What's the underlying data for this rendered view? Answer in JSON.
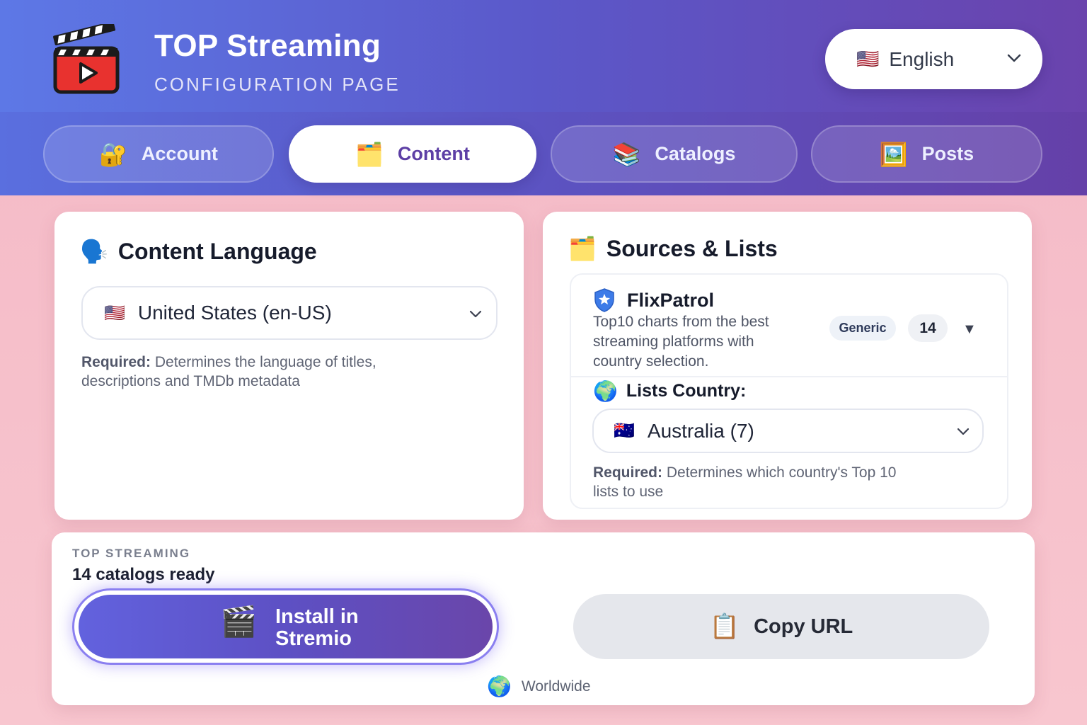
{
  "header": {
    "title": "TOP Streaming",
    "subtitle": "CONFIGURATION PAGE",
    "language": {
      "flag": "🇺🇸",
      "label": "English"
    }
  },
  "tabs": [
    {
      "icon": "🔐",
      "label": "Account",
      "active": false
    },
    {
      "icon": "🗂️",
      "label": "Content",
      "active": true
    },
    {
      "icon": "📚",
      "label": "Catalogs",
      "active": false
    },
    {
      "icon": "🖼️",
      "label": "Posts",
      "active": false
    }
  ],
  "content_language": {
    "icon": "🗣️",
    "title": "Content Language",
    "selected": {
      "flag": "🇺🇸",
      "label": "United States (en-US)"
    },
    "help_strong": "Required:",
    "help_text": " Determines the language of titles, descriptions and TMDb metadata"
  },
  "sources": {
    "icon": "🗂️",
    "title": "Sources & Lists",
    "source": {
      "name": "FlixPatrol",
      "description": "Top10 charts from the best streaming platforms with country selection.",
      "badge": "Generic",
      "count": "14",
      "toggle": "▼"
    },
    "country": {
      "icon": "🌍",
      "label": "Lists Country:",
      "selected": {
        "flag": "🇦🇺",
        "label": "Australia (7)"
      },
      "help_strong": "Required:",
      "help_text": " Determines which country's Top 10 lists to use"
    }
  },
  "install": {
    "eyebrow": "TOP STREAMING",
    "status": "14 catalogs ready",
    "install_icon": "🎬",
    "install_label": "Install in Stremio",
    "copy_icon": "📋",
    "copy_label": "Copy URL",
    "region_icon": "🌍",
    "region": "Worldwide"
  },
  "colors": {
    "accent": "#5d3fa5",
    "header_start": "#5d78e6",
    "header_end": "#6a43ad",
    "background": "#f6c1cb"
  }
}
